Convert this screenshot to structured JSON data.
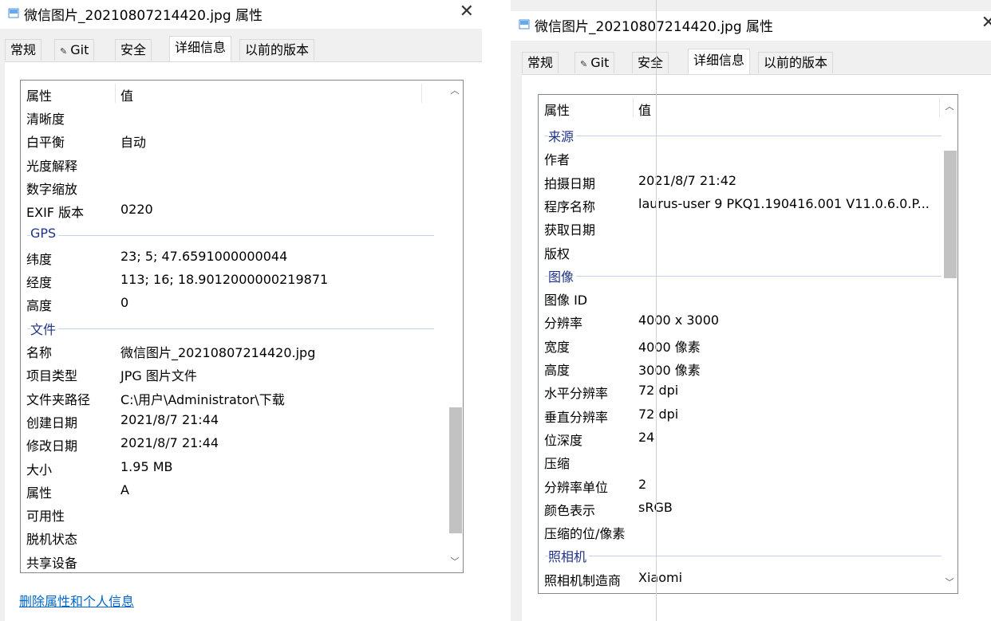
{
  "left": {
    "title": "微信图片_20210807214420.jpg 属性",
    "close": "✕",
    "tabs": [
      "常规",
      "Git",
      "安全",
      "详细信息",
      "以前的版本"
    ],
    "header": {
      "name": "属性",
      "value": "值"
    },
    "rows": [
      {
        "type": "item",
        "name": "清晰度",
        "value": ""
      },
      {
        "type": "item",
        "name": "白平衡",
        "value": "自动"
      },
      {
        "type": "item",
        "name": "光度解释",
        "value": ""
      },
      {
        "type": "item",
        "name": "数字缩放",
        "value": ""
      },
      {
        "type": "item",
        "name": "EXIF 版本",
        "value": "0220"
      },
      {
        "type": "group",
        "name": "GPS"
      },
      {
        "type": "item",
        "name": "纬度",
        "value": "23; 5; 47.6591000000044"
      },
      {
        "type": "item",
        "name": "经度",
        "value": "113; 16; 18.9012000000219871"
      },
      {
        "type": "item",
        "name": "高度",
        "value": "0"
      },
      {
        "type": "group",
        "name": "文件"
      },
      {
        "type": "item",
        "name": "名称",
        "value": "微信图片_20210807214420.jpg"
      },
      {
        "type": "item",
        "name": "项目类型",
        "value": "JPG 图片文件"
      },
      {
        "type": "item",
        "name": "文件夹路径",
        "value": "C:\\用户\\Administrator\\下载"
      },
      {
        "type": "item",
        "name": "创建日期",
        "value": "2021/8/7 21:44"
      },
      {
        "type": "item",
        "name": "修改日期",
        "value": "2021/8/7 21:44"
      },
      {
        "type": "item",
        "name": "大小",
        "value": "1.95 MB"
      },
      {
        "type": "item",
        "name": "属性",
        "value": "A"
      },
      {
        "type": "item",
        "name": "可用性",
        "value": ""
      },
      {
        "type": "item",
        "name": "脱机状态",
        "value": ""
      },
      {
        "type": "item",
        "name": "共享设备",
        "value": ""
      }
    ],
    "link": "删除属性和个人信息"
  },
  "right": {
    "title": "微信图片_20210807214420.jpg 属性",
    "close": "✕",
    "tabs": [
      "常规",
      "Git",
      "安全",
      "详细信息",
      "以前的版本"
    ],
    "header": {
      "name": "属性",
      "value": "值"
    },
    "rows": [
      {
        "type": "group",
        "name": "来源"
      },
      {
        "type": "item",
        "name": "作者",
        "value": ""
      },
      {
        "type": "item",
        "name": "拍摄日期",
        "value": "2021/8/7 21:42"
      },
      {
        "type": "item",
        "name": "程序名称",
        "value": "laurus-user 9 PKQ1.190416.001 V11.0.6.0.P..."
      },
      {
        "type": "item",
        "name": "获取日期",
        "value": ""
      },
      {
        "type": "item",
        "name": "版权",
        "value": ""
      },
      {
        "type": "group",
        "name": "图像"
      },
      {
        "type": "item",
        "name": "图像 ID",
        "value": ""
      },
      {
        "type": "item",
        "name": "分辨率",
        "value": "4000 x 3000"
      },
      {
        "type": "item",
        "name": "宽度",
        "value": "4000 像素"
      },
      {
        "type": "item",
        "name": "高度",
        "value": "3000 像素"
      },
      {
        "type": "item",
        "name": "水平分辨率",
        "value": "72 dpi"
      },
      {
        "type": "item",
        "name": "垂直分辨率",
        "value": "72 dpi"
      },
      {
        "type": "item",
        "name": "位深度",
        "value": "24"
      },
      {
        "type": "item",
        "name": "压缩",
        "value": ""
      },
      {
        "type": "item",
        "name": "分辨率单位",
        "value": "2"
      },
      {
        "type": "item",
        "name": "颜色表示",
        "value": "sRGB"
      },
      {
        "type": "item",
        "name": "压缩的位/像素",
        "value": ""
      },
      {
        "type": "group",
        "name": "照相机"
      },
      {
        "type": "item",
        "name": "照相机制造商",
        "value": "Xiaomi"
      }
    ]
  },
  "colors": {
    "group_text": "#1e3287",
    "link": "#0066cc",
    "scroll_thumb": "#c2c2c2"
  },
  "icons": {
    "file": "file-icon",
    "git": "git-icon",
    "scroll_up": "chevron-up-icon",
    "scroll_down": "chevron-down-icon"
  }
}
